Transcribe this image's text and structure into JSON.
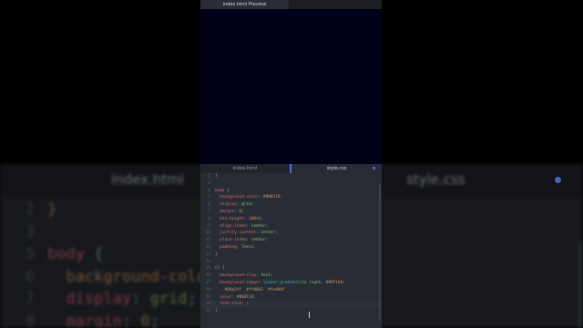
{
  "preview": {
    "tab_label": "index.html Preview",
    "background": "#000119"
  },
  "editor": {
    "tabs": [
      {
        "label": "index.html",
        "active": false
      },
      {
        "label": "style.css",
        "active": true
      }
    ],
    "lines": [
      {
        "n": "2",
        "text": "}"
      },
      {
        "n": "3",
        "text": ""
      },
      {
        "n": "4",
        "text": "body {"
      },
      {
        "n": "5",
        "text": "  background-color: #000119;"
      },
      {
        "n": "6",
        "text": "  display: grid;"
      },
      {
        "n": "7",
        "text": "  margin: 0;"
      },
      {
        "n": "8",
        "text": "  min-height: 100vh;"
      },
      {
        "n": "9",
        "text": "  align-items: center;"
      },
      {
        "n": "10",
        "text": "  justify-content: center;"
      },
      {
        "n": "11",
        "text": "  place-items: center;"
      },
      {
        "n": "12",
        "text": "  padding: 5vmin;"
      },
      {
        "n": "13",
        "text": "}"
      },
      {
        "n": "14",
        "text": ""
      },
      {
        "n": "15",
        "text": "h1 {"
      },
      {
        "n": "16",
        "text": "  background-clip: text;"
      },
      {
        "n": "17",
        "text": "  background-image: linear-gradient(to right, #09f1b8,"
      },
      {
        "n": "18",
        "text": "    #00a2ff, #ff00d2, #fed90f;"
      },
      {
        "n": "19",
        "text": "  color: #000119;"
      },
      {
        "n": "20",
        "text": "  font-size: ;"
      },
      {
        "n": "21",
        "text": "}"
      }
    ],
    "current_line": "20"
  },
  "background_copy": {
    "tabs": [
      "index.html",
      "style.css"
    ],
    "lines": [
      {
        "n": "2",
        "text": "}"
      },
      {
        "n": "3",
        "text": ""
      },
      {
        "n": "5",
        "text": "body {"
      },
      {
        "n": "6",
        "text": "  background-colo"
      },
      {
        "n": "7",
        "text": "  display: grid;"
      },
      {
        "n": "8",
        "text": "  margin: 0;"
      }
    ]
  },
  "colors": {
    "editor_bg": "#282c34",
    "accent": "#4b6fd6"
  }
}
